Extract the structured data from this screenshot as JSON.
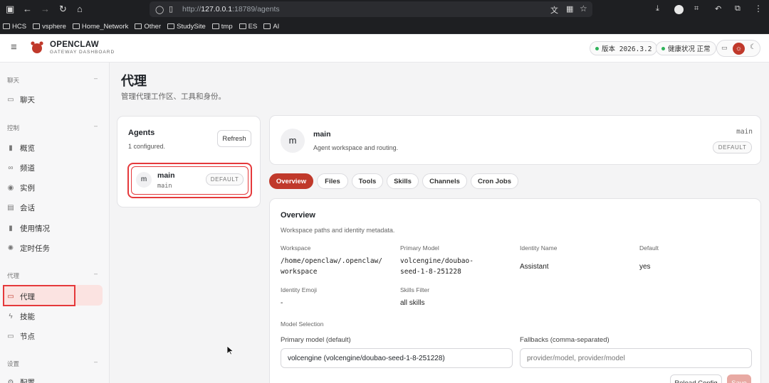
{
  "browser": {
    "url_prefix": "http://",
    "url_host": "127.0.0.1",
    "url_rest": ":18789/agents",
    "bookmarks": [
      "HCS",
      "vsphere",
      "Home_Network",
      "Other",
      "StudySite",
      "tmp",
      "ES",
      "AI"
    ]
  },
  "header": {
    "brand": "OPENCLAW",
    "subtitle": "GATEWAY DASHBOARD",
    "version": "版本 2026.3.2",
    "health": "健康状况 正常"
  },
  "sidebar": {
    "sections": [
      {
        "title": "聊天",
        "items": [
          "聊天"
        ]
      },
      {
        "title": "控制",
        "items": [
          "概览",
          "频道",
          "实例",
          "会话",
          "使用情况",
          "定时任务"
        ]
      },
      {
        "title": "代理",
        "items": [
          "代理",
          "技能",
          "节点"
        ]
      },
      {
        "title": "设置",
        "items": [
          "配置"
        ]
      }
    ],
    "collapse_glyph": "–"
  },
  "page": {
    "title": "代理",
    "subtitle": "管理代理工作区、工具和身份。"
  },
  "agents_panel": {
    "title": "Agents",
    "count": "1 configured.",
    "refresh": "Refresh",
    "agent": {
      "avatar": "m",
      "name": "main",
      "id": "main",
      "badge": "DEFAULT"
    }
  },
  "agent_header": {
    "avatar": "m",
    "name": "main",
    "desc": "Agent workspace and routing.",
    "id": "main",
    "badge": "DEFAULT"
  },
  "tabs": [
    "Overview",
    "Files",
    "Tools",
    "Skills",
    "Channels",
    "Cron Jobs"
  ],
  "overview": {
    "title": "Overview",
    "subtitle": "Workspace paths and identity metadata.",
    "fields": {
      "workspace_label": "Workspace",
      "workspace_line1": "/home/openclaw/.openclaw/",
      "workspace_line2": "workspace",
      "model_label": "Primary Model",
      "model_line1": "volcengine/doubao-",
      "model_line2": "seed-1-8-251228",
      "identity_label": "Identity Name",
      "identity_value": "Assistant",
      "default_label": "Default",
      "default_value": "yes",
      "emoji_label": "Identity Emoji",
      "emoji_value": "-",
      "skills_label": "Skills Filter",
      "skills_value": "all skills"
    },
    "model_selection_label": "Model Selection",
    "primary_model_label": "Primary model (default)",
    "primary_model_value": "volcengine (volcengine/doubao-seed-1-8-251228)",
    "fallbacks_label": "Fallbacks (comma-separated)",
    "fallbacks_placeholder": "provider/model, provider/model",
    "reload": "Reload Config",
    "save": "Save"
  },
  "colors": {
    "accent": "#c0392b",
    "accent_light": "#fbe3e1",
    "health": "#2fb35a"
  }
}
